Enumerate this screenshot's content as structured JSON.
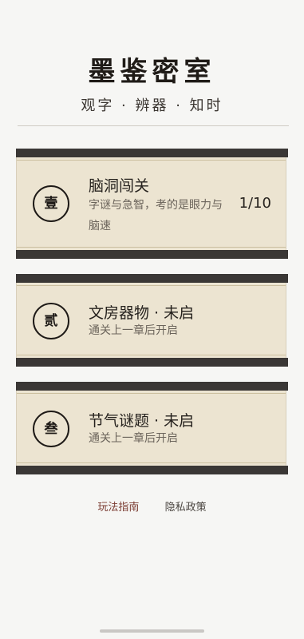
{
  "header": {
    "title": "墨鉴密室",
    "subtitle": "观字 · 辨器 · 知时"
  },
  "chapters": [
    {
      "seal": "壹",
      "title": "脑洞闯关",
      "description": "字谜与急智，考的是眼力与脑速",
      "progress": "1/10",
      "locked": false
    },
    {
      "seal": "贰",
      "title": "文房器物 · 未启",
      "description": "通关上一章后开启",
      "locked": true
    },
    {
      "seal": "叁",
      "title": "节气谜题 · 未启",
      "description": "通关上一章后开启",
      "locked": true
    }
  ],
  "footer": {
    "guide_label": "玩法指南",
    "privacy_label": "隐私政策"
  },
  "colors": {
    "card_bg": "#ece4d1",
    "bar": "#3a3735",
    "guide_link": "#7a3b31"
  }
}
